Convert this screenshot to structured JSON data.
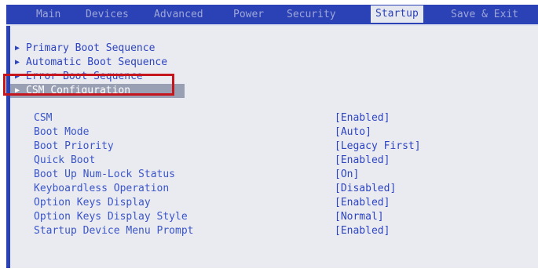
{
  "menu": {
    "tabs": [
      {
        "label": "Main"
      },
      {
        "label": "Devices"
      },
      {
        "label": "Advanced"
      },
      {
        "label": "Power"
      },
      {
        "label": "Security"
      },
      {
        "label": "Startup"
      },
      {
        "label": "Save & Exit"
      }
    ],
    "active_tab": "Startup"
  },
  "submenus": [
    {
      "label": "Primary Boot Sequence",
      "icon": "triangle-right-icon"
    },
    {
      "label": "Automatic Boot Sequence",
      "icon": "triangle-right-icon"
    },
    {
      "label": "Error Boot Sequence",
      "icon": "triangle-right-icon"
    },
    {
      "label": "CSM Configuration",
      "icon": "triangle-right-icon",
      "selected": true
    }
  ],
  "settings": [
    {
      "label": "CSM",
      "value": "[Enabled]"
    },
    {
      "label": "Boot Mode",
      "value": "[Auto]"
    },
    {
      "label": "Boot Priority",
      "value": "[Legacy First]"
    },
    {
      "label": "Quick Boot",
      "value": "[Enabled]"
    },
    {
      "label": "Boot Up Num-Lock Status",
      "value": "[On]"
    },
    {
      "label": "Keyboardless Operation",
      "value": "[Disabled]"
    },
    {
      "label": "Option Keys Display",
      "value": "[Enabled]"
    },
    {
      "label": "Option Keys Display Style",
      "value": "[Normal]"
    },
    {
      "label": "Startup Device Menu Prompt",
      "value": "[Enabled]"
    }
  ],
  "colors": {
    "menubar": "#2b41b6",
    "panel": "#eaebf1",
    "highlight_border": "#c4161c",
    "text_blue": "#2d44c0"
  }
}
